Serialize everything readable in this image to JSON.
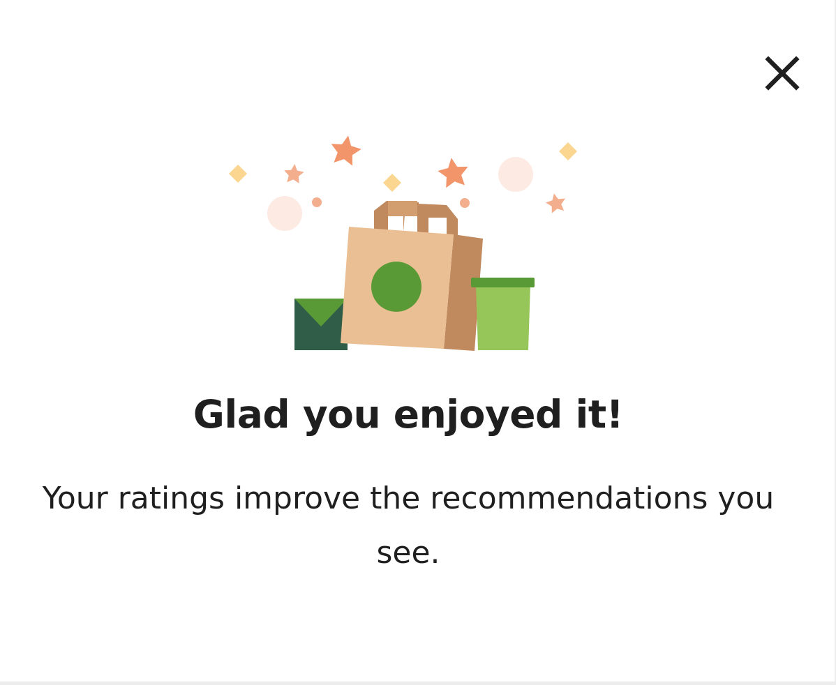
{
  "dialog": {
    "close": {
      "icon": "close-icon",
      "label": "Close"
    },
    "illustration": {
      "icon": "shopping-bag-celebration-illustration",
      "colors": {
        "bag": "#EABF93",
        "bag_shadow": "#C0895E",
        "bag_dot": "#5A9A36",
        "envelope": "#2F5D48",
        "envelope_flap": "#5A9A36",
        "cup": "#96C65A",
        "cup_lid": "#5A9A36",
        "star": "#F2956A",
        "star_light": "#F3AE8E",
        "diamond": "#FAD690",
        "bubble": "#FCEAE3"
      }
    },
    "title": "Glad you enjoyed it!",
    "message": "Your ratings improve the recommendations you see."
  }
}
